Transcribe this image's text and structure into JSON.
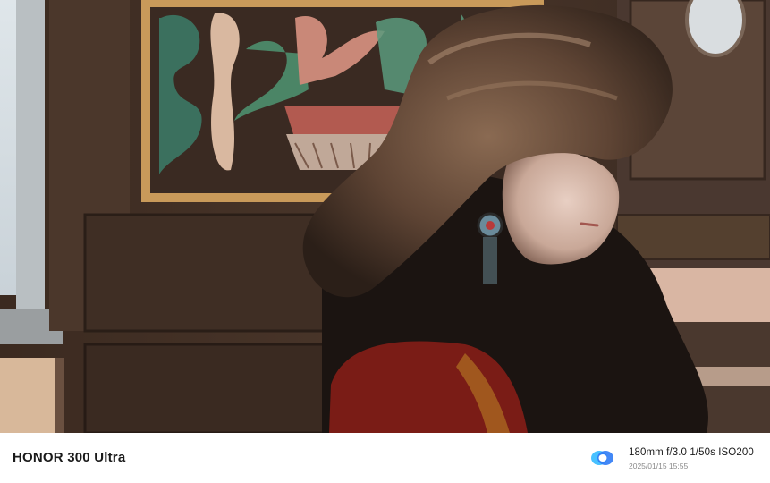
{
  "watermark": {
    "device": "HONOR 300 Ultra",
    "exif": "180mm  f/3.0  1/50s  ISO200",
    "datetime": "2025/01/15 15:55",
    "logo_icon": "honor-camera-logo-icon",
    "logo_colors": [
      "#2f7bf5",
      "#48c1ff"
    ]
  },
  "photo": {
    "subject": "portrait-in-fur-hat-icon"
  }
}
